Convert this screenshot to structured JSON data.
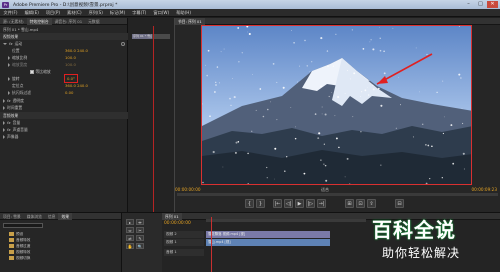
{
  "window": {
    "title": "Adobe Premiere Pro - D:\\创意视频\\雪景.prproj *",
    "app_icon": "Pr",
    "controls": [
      "–",
      "□",
      "✕"
    ]
  },
  "menu": [
    "文件(F)",
    "编辑(E)",
    "项目(P)",
    "素材(C)",
    "序列(S)",
    "标记(M)",
    "字幕(T)",
    "窗口(W)",
    "帮助(H)"
  ],
  "effects_panel": {
    "tabs": [
      "源: (无素材)",
      "特效控制台",
      "调音台: 序列 01",
      "元数据"
    ],
    "clip_header": "序列 01 * 雪山.mp4",
    "sections": {
      "video_effects": "视频效果",
      "motion": "运动",
      "opacity": "透明度",
      "time_remap": "时间重置",
      "audio_effects": "音频效果",
      "volume": "音量",
      "channel_volume": "声道音量",
      "panner": "声像器"
    },
    "properties": [
      {
        "name": "位置",
        "value": "360.0   240.0"
      },
      {
        "name": "缩放比例",
        "value": "100.0"
      },
      {
        "name": "缩放宽度",
        "value": "100.0"
      },
      {
        "name": "等比缩放",
        "value": ""
      },
      {
        "name": "旋转",
        "value": "0.0°"
      },
      {
        "name": "定位点",
        "value": "360.0   240.0"
      },
      {
        "name": "抗闪烁过滤",
        "value": "0.00"
      }
    ],
    "equal_scale_checked": true,
    "highlight_color": "#e02020"
  },
  "program_monitor": {
    "tab": "节目: 序列 01",
    "timecode_current": "00:00:00:00",
    "timecode_duration": "00:00:09:23",
    "zoom": "适合",
    "transport": [
      "{",
      "}",
      "|←",
      "◁|",
      "▶",
      "|▷",
      "→|",
      "⊞",
      "⊡",
      "⇪",
      "⊟"
    ]
  },
  "project_panel": {
    "tabs": [
      "项目: 雪景",
      "媒体浏览",
      "信息",
      "效果"
    ],
    "items": [
      "预设",
      "音频特效",
      "音频过渡",
      "视频特效",
      "视频切换"
    ]
  },
  "tools": [
    "▸",
    "⇹",
    "⇔",
    "✂",
    "⇄",
    "✎",
    "✋",
    "🔍"
  ],
  "timeline": {
    "tab": "序列 01",
    "timecode": "00:00:00:00",
    "tracks": [
      {
        "label": "视频 2",
        "clip": "雪花飘落 视频.mp4 [视]"
      },
      {
        "label": "视频 1",
        "clip": "雪山.mp4 [视]"
      },
      {
        "label": "音频 1",
        "clip": ""
      }
    ]
  },
  "watermark": {
    "line1": "百科全说",
    "line2": "助你轻松解决"
  },
  "colors": {
    "accent": "#e6a423",
    "selection_red": "#d93030"
  }
}
